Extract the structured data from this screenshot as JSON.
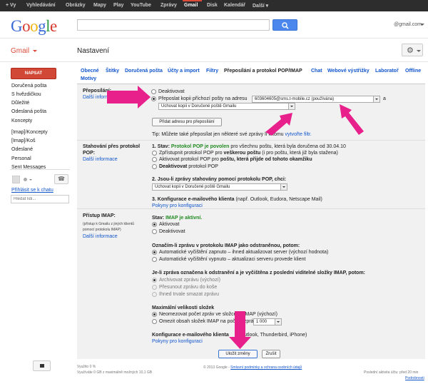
{
  "topbar": {
    "items": [
      "+ Vy",
      "Vyhledávání",
      "Obrázky",
      "Mapy",
      "Play",
      "YouTube",
      "Zprávy",
      "Gmail",
      "Disk",
      "Kalendář",
      "Další ▾"
    ]
  },
  "header": {
    "logo": [
      "G",
      "o",
      "o",
      "g",
      "l",
      "e"
    ],
    "account": "@gmail.com",
    "app_label": "Gmail",
    "page_title": "Nastavení"
  },
  "sidebar": {
    "compose_label": "NAPSAT",
    "items": [
      "Doručená pošta",
      "S hvězdičkou",
      "Důležité",
      "Odeslaná pošta",
      "Koncepty",
      "[Imap]/Koncepty",
      "[Imap]/Koš",
      "Odeslané",
      "Personal",
      "Sent Messages"
    ],
    "chat_signin": "Přihlásit se k chatu",
    "people_placeholder": "Hledat lidi..."
  },
  "tabs": [
    "Obecné",
    "Štítky",
    "Doručená pošta",
    "Účty a import",
    "Filtry",
    "Přeposílání a protokol POP/IMAP",
    "Chat",
    "Webové výstřižky",
    "Laboratoř",
    "Offline",
    "Motivy"
  ],
  "forwarding": {
    "label": "Přeposílání:",
    "learn": "Další informace",
    "opt_off": "Deaktivovat",
    "opt_on": "Přeposlat kopii příchozí pošty na adresu",
    "address": "603604605@sms.t-mobile.cz  (používána)",
    "and": "a",
    "keep": "Uchovat kopii v Doručené poště Gmailu",
    "add_btn": "Přidat adresu pro přeposílání",
    "tip_prefix": "Tip: Můžete také přeposílat jen některé své zprávy",
    "tip_mid": "lí k tomu",
    "tip_link": "vytvořte filtr."
  },
  "pop": {
    "label1": "Stahování přes protokol",
    "label2": "POP:",
    "learn": "Další informace",
    "status_prefix": "1. Stav:",
    "status_on": "Protokol POP je povolen",
    "status_rest": "pro všechnu poštu, která byla doručena od 30.04.10",
    "opt1_a": "Zpřístupnit protokol POP pro",
    "opt1_b": "veškerou poštu",
    "opt1_c": "(i pro poštu, která již byla stažena)",
    "opt2_a": "Aktivovat protokol POP pro",
    "opt2_b": "poštu, která přijde od tohoto okamžiku",
    "opt3_a": "Deaktivovat",
    "opt3_b": "protokol POP",
    "q2": "2. Jsou-li zprávy stahovány pomocí protokolu POP, chci:",
    "q2_value": "Uchovat kopii v Doručené poště Gmailu",
    "q3_a": "3. Konfigurace e-mailového klienta",
    "q3_b": "(např. Outlook, Eudora, Netscape Mail)",
    "instructions": "Pokyny pro konfiguraci"
  },
  "imap": {
    "label": "Přístup IMAP:",
    "sub1": "(přístup k Gmailu z jiných klientů",
    "sub2": "pomocí protokolu IMAP)",
    "learn": "Další informace",
    "status_prefix": "Stav:",
    "status_on": "IMAP je aktivní.",
    "opt_on": "Aktivovat",
    "opt_off": "Deaktivovat",
    "q_mark": "Označím-li zprávu v protokolu IMAP jako odstraněnou, potom:",
    "mark1": "Automatické vyčištění zapnuto – ihned aktualizovat server (výchozí hodnota)",
    "mark2": "Automatické vyčištění vypnuto – aktualizaci serveru provede klient",
    "q_delete": "Je-li zpráva označena k odstranění a je vyčištěna z poslední viditelné složky IMAP, potom:",
    "del1": "Archivovat zprávu (výchozí)",
    "del2": "Přesunout zprávu do koše",
    "del3": "Ihned trvale smazat zprávu",
    "q_size": "Maximální velikosti složek",
    "size1_a": "Neomezovat počet zpráv ve složce",
    "size1_b": "MAP (výchozí)",
    "size2_a": "Omezit obsah složek IMAP na poč",
    "size2_b": "zpráv",
    "size_value": "1 000",
    "client_a": "Konfigurace e-mailového klienta",
    "client_b": "Outlook, Thunderbird, iPhone)",
    "instructions": "Pokyny pro konfiguraci"
  },
  "actions": {
    "save": "Uložit změny",
    "cancel": "Zrušit"
  },
  "footer": {
    "usage1": "Využito 0 %",
    "usage2": "Využíváte 0 GB z maximálně možných 10,1 GB",
    "copyright": "© 2013 Google -",
    "terms": "Smluvní podmínky a ochrana osobních údajů",
    "activity1": "Poslední aktivita účtu: před 20 min",
    "activity2": "Podrobnosti"
  }
}
